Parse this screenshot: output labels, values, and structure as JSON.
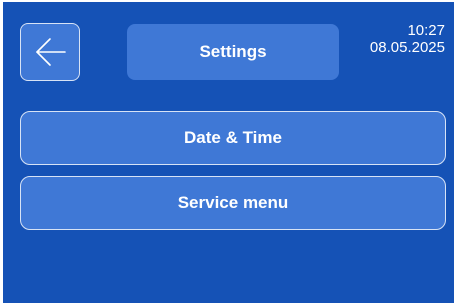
{
  "header": {
    "title": "Settings",
    "time": "10:27",
    "date": "08.05.2025",
    "back_icon": "arrow-left-icon"
  },
  "menu": {
    "items": [
      {
        "label": "Date & Time"
      },
      {
        "label": "Service menu"
      }
    ]
  },
  "colors": {
    "background": "#1552b6",
    "button": "#3f78d6",
    "border": "#d7e3f6",
    "text": "#ffffff"
  }
}
